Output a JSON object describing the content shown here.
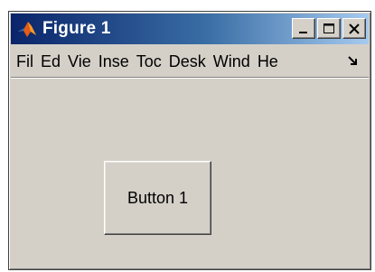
{
  "window": {
    "title": "Figure 1",
    "app_icon": "matlab-logo-icon",
    "controls": {
      "minimize_icon": "minimize-icon",
      "maximize_icon": "maximize-icon",
      "close_icon": "close-icon"
    }
  },
  "menubar": {
    "items": [
      {
        "label": "Fil"
      },
      {
        "label": "Ed"
      },
      {
        "label": "Vie"
      },
      {
        "label": "Inse"
      },
      {
        "label": "Toc"
      },
      {
        "label": "Desk"
      },
      {
        "label": "Wind"
      },
      {
        "label": "He"
      }
    ],
    "overflow_icon": "chevron-overflow-icon"
  },
  "canvas": {
    "button": {
      "label": "Button 1"
    }
  },
  "colors": {
    "titlebar_start": "#0a246a",
    "titlebar_end": "#a6caf0",
    "face": "#d4d0c8"
  }
}
